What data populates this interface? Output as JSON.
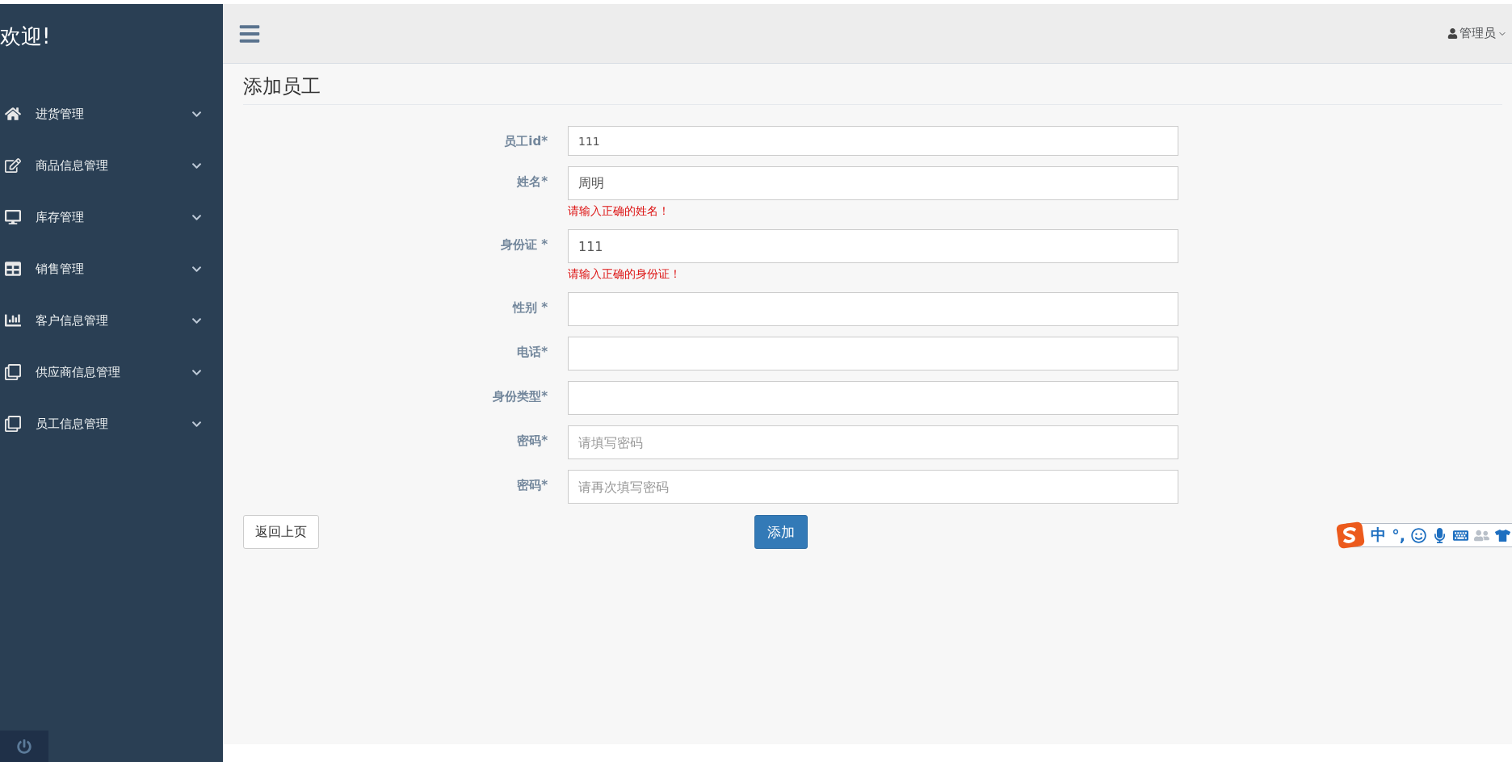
{
  "sidebar": {
    "title": "欢迎!",
    "items": [
      {
        "label": "进货管理",
        "expanded": false
      },
      {
        "label": "商品信息管理",
        "expanded": false
      },
      {
        "label": "库存管理",
        "expanded": false
      },
      {
        "label": "销售管理",
        "expanded": false
      },
      {
        "label": "客户信息管理",
        "expanded": false
      },
      {
        "label": "供应商信息管理",
        "expanded": false
      },
      {
        "label": "员工信息管理",
        "expanded": false
      }
    ]
  },
  "header": {
    "user": "管理员"
  },
  "page_title": "添加员工",
  "form": {
    "fields": [
      {
        "label": "员工id*",
        "value": "111"
      },
      {
        "label": "姓名*",
        "value": "周明",
        "error": "请输入正确的姓名！"
      },
      {
        "label": "身份证 *",
        "value": "111",
        "error": "请输入正确的身份证！"
      },
      {
        "label": "性别 *"
      },
      {
        "label": "电话*"
      },
      {
        "label": "身份类型*"
      },
      {
        "label": "密码*",
        "placeholder": "请填写密码"
      },
      {
        "label": "密码*",
        "placeholder": "请再次填写密码"
      }
    ]
  },
  "buttons": {
    "back": "返回上页",
    "submit": "添加"
  },
  "ime_toolbar": {
    "mode": "中",
    "punctuation": "°,"
  }
}
